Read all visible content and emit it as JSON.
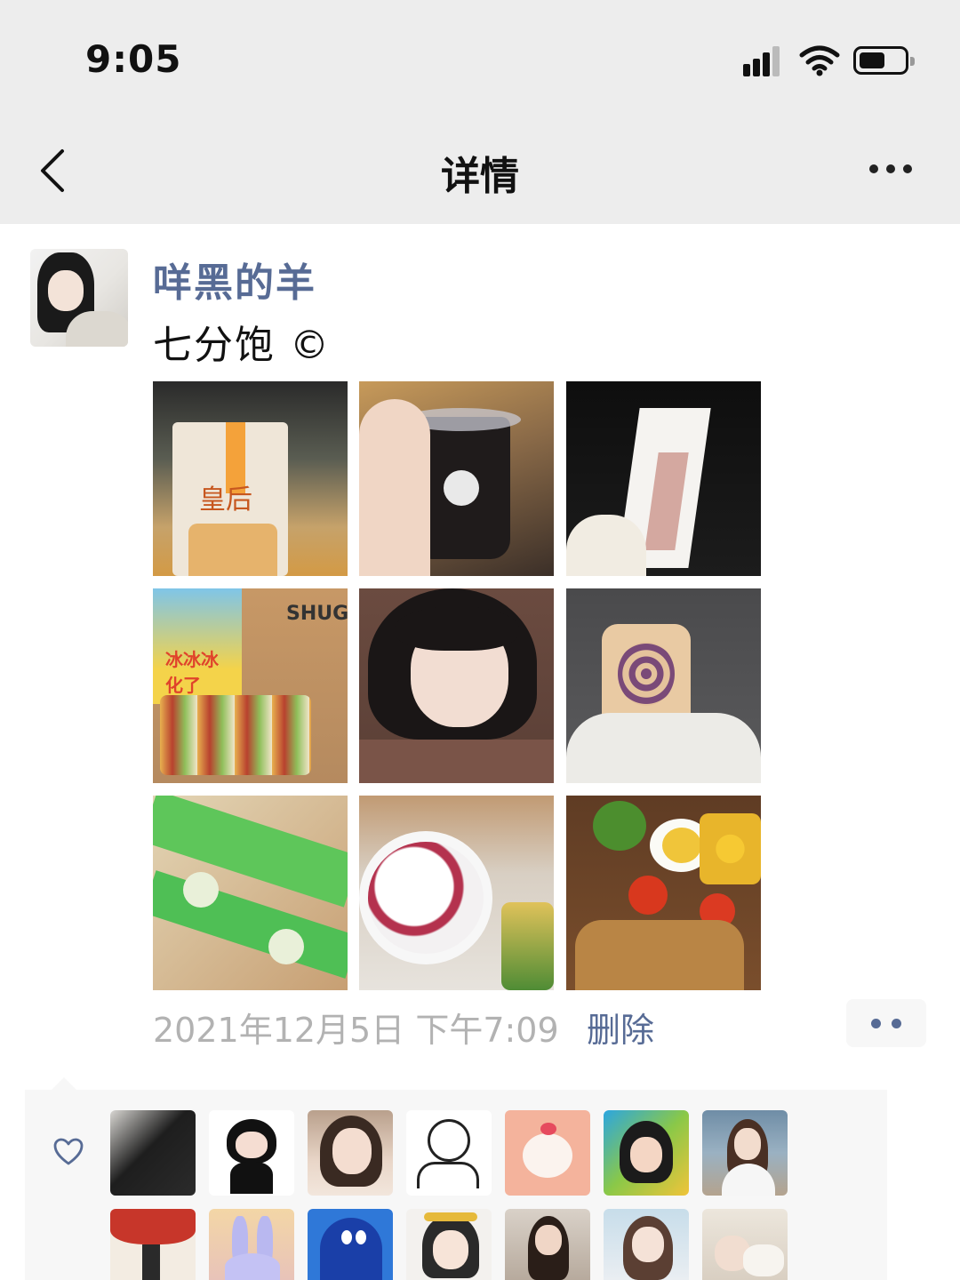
{
  "status_bar": {
    "time": "9:05"
  },
  "nav": {
    "title": "详情"
  },
  "post": {
    "username": "咩黑的羊",
    "text": "七分饱 ©",
    "time": "2021年12月5日 下午7:09",
    "delete_label": "删除"
  },
  "photo_labels": {
    "bread_brand": "皇后",
    "sign_text": "SHUG",
    "pack_text": "冰冰冰化了"
  },
  "colors": {
    "link": "#576b95",
    "nav_bg": "#ededed",
    "likes_bg": "#f7f7f7",
    "meta_gray": "#b2b2b2"
  },
  "icons": [
    "back-chevron-icon",
    "more-dots-icon",
    "signal-icon",
    "wifi-icon",
    "battery-icon",
    "heart-icon",
    "comment-dots-icon"
  ]
}
